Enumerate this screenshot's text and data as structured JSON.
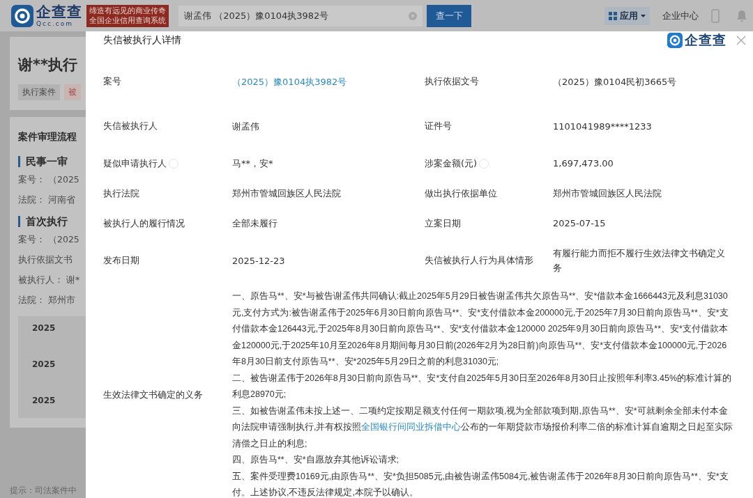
{
  "header": {
    "logo": "企查查",
    "logo_sub": "Qcc.com",
    "slogan": [
      "缔造有远见的商业传奇",
      "全国企业信用查询系统"
    ],
    "search": {
      "value": "谢孟伟 （2025）豫0104执3982号"
    },
    "search_button": "查一下",
    "apps_menu": "应用",
    "enterprise_center": "企业中心"
  },
  "background": {
    "title": "谢**执行",
    "tags": [
      {
        "label": "执行案件",
        "kind": "plain"
      },
      {
        "label": "被",
        "kind": "alert"
      }
    ],
    "process_title": "案件审理流程",
    "sections": [
      {
        "heading": "民事一审",
        "lines": [
          {
            "label": "案号：",
            "value": "（2025"
          },
          {
            "label": "法院：",
            "value": "河南省"
          }
        ]
      },
      {
        "heading": "首次执行",
        "lines": [
          {
            "label": "案号：",
            "value": "（2025"
          },
          {
            "label": "执行依据文书"
          },
          {
            "label": "被执行人：",
            "value": "谢*"
          },
          {
            "label": "法院：",
            "value": "郑州市"
          }
        ]
      }
    ],
    "timeline": [
      "2025",
      "2025",
      "2025"
    ],
    "tip": "提示：司法案件中"
  },
  "modal": {
    "title": "失信被执行人详情",
    "brand": "企查查",
    "rows": [
      {
        "cells": [
          {
            "label": "案号",
            "value": "（2025）豫0104执3982号",
            "kind": "link",
            "info": false
          },
          {
            "label": "执行依据文号",
            "value": "（2025）豫0104民初3665号",
            "kind": "text",
            "info": false
          }
        ]
      },
      {
        "cells": [
          {
            "label": "失信被执行人",
            "value": "谢孟伟",
            "kind": "text",
            "info": false
          },
          {
            "label": "证件号",
            "value": "1101041989****1233",
            "kind": "text",
            "info": false
          }
        ]
      },
      {
        "cells": [
          {
            "label": "疑似申请执行人",
            "value": "马**，安*",
            "kind": "text",
            "info": true
          },
          {
            "label": "涉案金额(元)",
            "value": "1,697,473.00",
            "kind": "text",
            "info": true
          }
        ]
      },
      {
        "cells": [
          {
            "label": "执行法院",
            "value": "郑州市管城回族区人民法院",
            "kind": "text",
            "info": false
          },
          {
            "label": "做出执行依据单位",
            "value": "郑州市管城回族区人民法院",
            "kind": "text",
            "info": false
          }
        ]
      },
      {
        "cells": [
          {
            "label": "被执行人的履行情况",
            "value": "全部未履行",
            "kind": "text",
            "info": false
          },
          {
            "label": "立案日期",
            "value": "2025-07-15",
            "kind": "text",
            "info": false
          }
        ]
      },
      {
        "cells": [
          {
            "label": "发布日期",
            "value": "2025-12-23",
            "kind": "text",
            "info": false
          },
          {
            "label": "失信被执行人行为具体情形",
            "value": "有履行能力而拒不履行生效法律文书确定义务",
            "kind": "text",
            "info": false
          }
        ]
      }
    ],
    "obligation": {
      "label": "生效法律文书确定的义务",
      "paragraphs": [
        [
          {
            "text": "一、原告马**、安*与被告谢孟伟共同确认:截止2025年5月29日被告谢孟伟共欠原告马**、安*借款本金1666443元及利息31030元,支付方式为:被告谢孟伟于2025年6月30日前向原告马**、安*支付借款本金200000元,于2025年7月30日前向原告马**、安*支付借款本金126443元,于2025年8月30日前向原告马**、安*支付借款本金120000 2025年9月30日前向原告马**、安*支付借款本金120000元,于2025年10月至2026年8月期间每月30日前(2026年2月为28日前)向原告马**、安*支付借款本金100000元,于2026年8月30日前支付原告马**、安*2025年5月29日之前的利息31030元;",
            "link": false
          }
        ],
        [
          {
            "text": "二、被告谢孟伟于2026年8月30日前向原告马**、安*支付自2025年5月30日至2026年8月30日止按照年利率3.45%的标准计算的利息28970元;",
            "link": false
          }
        ],
        [
          {
            "text": "三、如被告谢孟伟未按上述一、二项约定按期足额支付任何一期款项,视为全部款项到期,原告马**、安*可就剩余全部未付本金向法院申请强制执行,并有权按照",
            "link": false
          },
          {
            "text": "全国银行间同业拆借中心",
            "link": true
          },
          {
            "text": "公布的一年期贷款市场报价利率二倍的标准计算自逾期之日起至实际清偿之日止的利息;",
            "link": false
          }
        ],
        [
          {
            "text": "四、原告马**、安*自愿放弃其他诉讼请求;",
            "link": false
          }
        ],
        [
          {
            "text": "五、案件受理费10169元,由原告马**、安*负担5085元,由被告谢孟伟5084元,被告谢孟伟于2026年8月30日前向原告马**、安*支付。上述协议,不违反法律规定,本院予以确认。",
            "link": false
          }
        ]
      ]
    }
  }
}
